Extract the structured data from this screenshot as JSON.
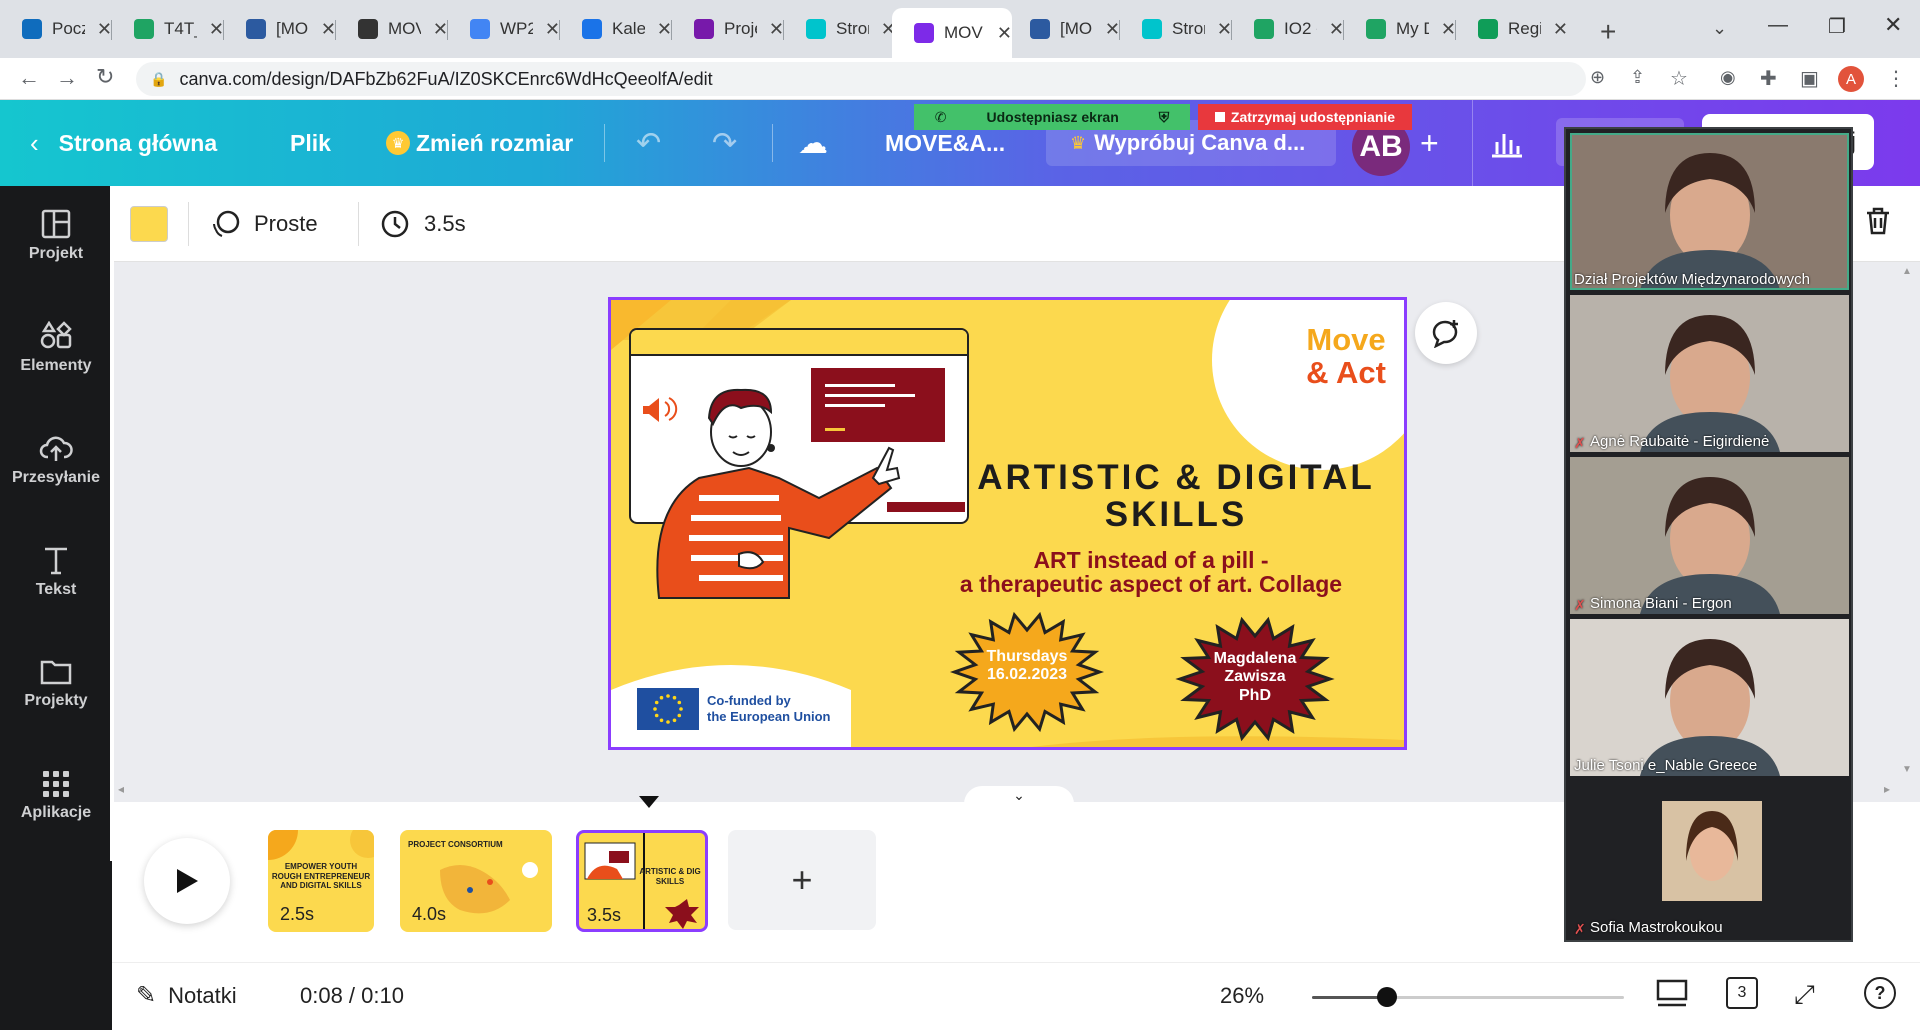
{
  "browser": {
    "tabs": [
      {
        "label": "Pocz",
        "icon": "outlook-icon",
        "color": "#0f6cbd"
      },
      {
        "label": "T4T_",
        "icon": "drive-icon",
        "color": "#1fa463"
      },
      {
        "label": "[MO",
        "icon": "mendeley-icon",
        "color": "#2c5aa0"
      },
      {
        "label": "MOV",
        "icon": "github-icon",
        "color": "#333333"
      },
      {
        "label": "WP2",
        "icon": "docs-icon",
        "color": "#4285f4"
      },
      {
        "label": "Kale",
        "icon": "calendar-icon",
        "color": "#1a73e8"
      },
      {
        "label": "Proje",
        "icon": "onenote-icon",
        "color": "#7719aa"
      },
      {
        "label": "Stron",
        "icon": "canva-icon",
        "color": "#00c4cc"
      },
      {
        "label": "MOV",
        "icon": "canva-icon",
        "color": "#7d2ae8"
      },
      {
        "label": "[MO",
        "icon": "mendeley-icon",
        "color": "#2c5aa0"
      },
      {
        "label": "Stron",
        "icon": "canva-icon",
        "color": "#00c4cc"
      },
      {
        "label": "IO2 -",
        "icon": "drive-icon",
        "color": "#1fa463"
      },
      {
        "label": "My D",
        "icon": "drive-icon",
        "color": "#1fa463"
      },
      {
        "label": "Regi",
        "icon": "sheets-icon",
        "color": "#0f9d58"
      }
    ],
    "url": "canva.com/design/DAFbZb62FuA/IZ0SKCEnrc6WdHcQeeolfA/edit",
    "profile_initial": "A"
  },
  "header": {
    "home_label": "Strona główna",
    "file_label": "Plik",
    "resize_label": "Zmień rozmiar",
    "title": "MOVE&A...",
    "try_pro_label": "Wypróbuj Canva d...",
    "avatar_initials": "AB",
    "share_label": "onij",
    "sharing_label": "Udostępniasz ekran",
    "stop_sharing_label": "Zatrzymaj udostępnianie"
  },
  "sidebar": {
    "items": [
      {
        "label": "Projekt"
      },
      {
        "label": "Elementy"
      },
      {
        "label": "Przesyłanie"
      },
      {
        "label": "Tekst"
      },
      {
        "label": "Projekty"
      },
      {
        "label": "Aplikacje"
      }
    ]
  },
  "toolbar": {
    "color": "#fcd94e",
    "animation_label": "Proste",
    "duration_label": "3.5s"
  },
  "slide": {
    "brand_line1": "Move",
    "brand_line2": "& Act",
    "title_line1": "ARTISTIC & DIGITAL",
    "title_line2": "SKILLS",
    "subtitle_line1": "ART instead of a pill -",
    "subtitle_line2": "a therapeutic aspect of art. Collage",
    "date_line1": "Thursdays",
    "date_line2": "16.02.2023",
    "speaker_line1": "Magdalena",
    "speaker_line2": "Zawisza",
    "speaker_line3": "PhD",
    "eu_line1": "Co-funded by",
    "eu_line2": "the European Union"
  },
  "timeline": {
    "pages": [
      {
        "duration": "2.5s",
        "text_1": "EMPOWER YOUTH",
        "text_2": "ROUGH ENTREPRENEUR",
        "text_3": "AND DIGITAL SKILLS"
      },
      {
        "duration": "4.0s",
        "text_1": "PROJECT CONSORTIUM"
      },
      {
        "duration": "3.5s",
        "text_1": "ARTISTIC & DIG",
        "text_2": "SKILLS"
      }
    ]
  },
  "bottombar": {
    "notes_label": "Notatki",
    "time": "0:08 / 0:10",
    "zoom": "26%",
    "zoom_level": 0.24,
    "page_count": "3"
  },
  "participants": [
    {
      "name": "Dział Projektów Międzynarodowych",
      "muted": false,
      "bg": "#8a7a6e"
    },
    {
      "name": "Agnė Raubaitė - Eigirdienė",
      "muted": true,
      "bg": "#b8b2aa"
    },
    {
      "name": "Simona Biani - Ergon",
      "muted": true,
      "bg": "#a49e92"
    },
    {
      "name": "Julie Tsoni e_Nable Greece",
      "muted": false,
      "bg": "#d9d4ce"
    },
    {
      "name": "Sofia Mastrokoukou",
      "muted": true,
      "bg": "#202124"
    }
  ]
}
